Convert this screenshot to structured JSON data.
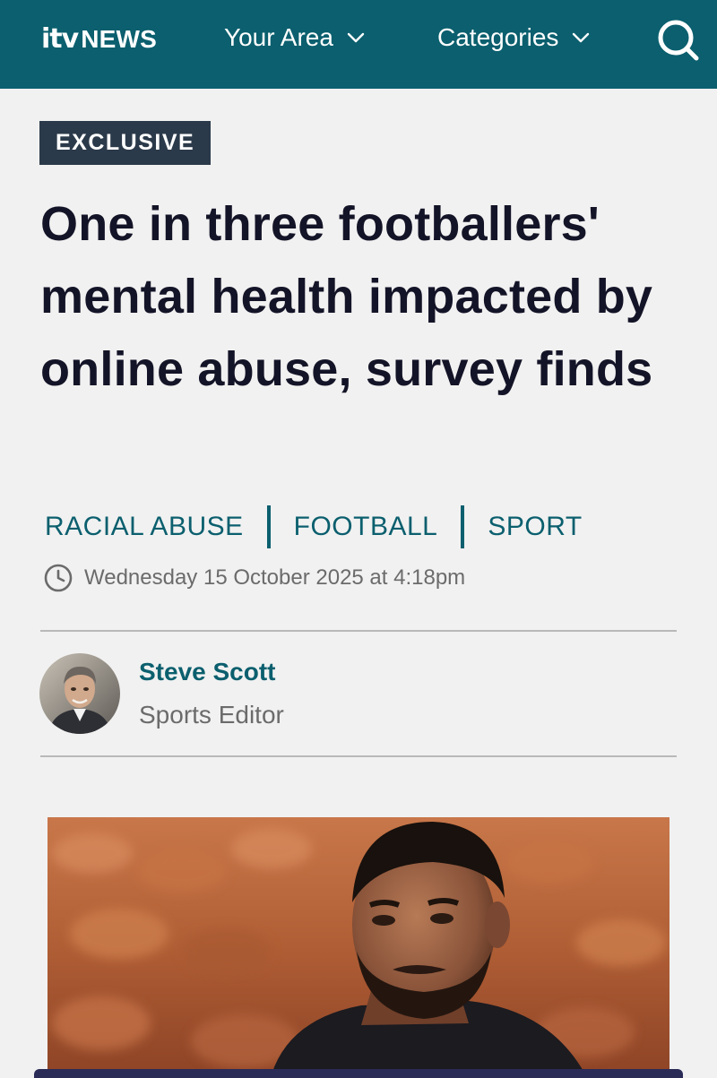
{
  "header": {
    "logo_itv": "itv",
    "logo_news": "NEWS",
    "nav": [
      {
        "label": "Your Area"
      },
      {
        "label": "Categories"
      }
    ],
    "search_icon": "search-icon",
    "background_color": "#0b5f6e"
  },
  "article": {
    "badge": "EXCLUSIVE",
    "headline": "One in three footballers' mental health impacted by online abuse, survey finds",
    "tags": [
      "RACIAL ABUSE",
      "FOOTBALL",
      "SPORT"
    ],
    "date": "Wednesday 15 October 2025 at 4:18pm",
    "author": {
      "name": "Steve Scott",
      "role": "Sports Editor"
    }
  },
  "colors": {
    "accent": "#0b5f6e",
    "headline": "#141428",
    "muted": "#6b6b6b",
    "badge_bg": "#2b3a4a"
  }
}
